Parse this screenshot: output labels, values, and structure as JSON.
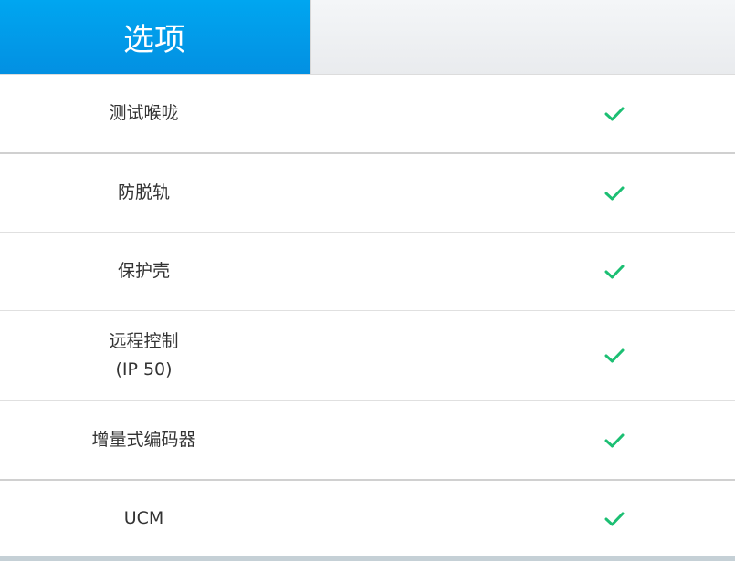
{
  "header": {
    "title": "选项"
  },
  "rows": [
    {
      "label": "测试喉咙",
      "label2": "",
      "check": "check-icon"
    },
    {
      "label": "防脱轨",
      "label2": "",
      "check": "check-icon"
    },
    {
      "label": "保护壳",
      "label2": "",
      "check": "check-icon"
    },
    {
      "label": "远程控制",
      "label2": "(IP 50)",
      "check": "check-icon"
    },
    {
      "label": "增量式编码器",
      "label2": "",
      "check": "check-icon"
    },
    {
      "label": "UCM",
      "label2": "",
      "check": "check-icon"
    }
  ],
  "colors": {
    "header_blue": "#00a6f0",
    "check_green": "#1cbf73"
  }
}
